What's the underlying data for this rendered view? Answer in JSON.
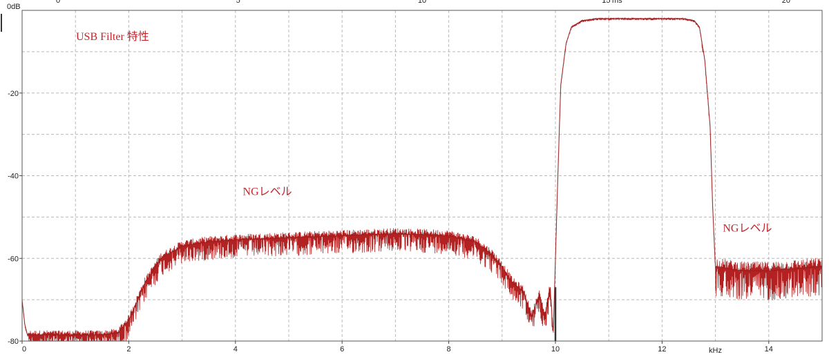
{
  "chart_data": {
    "type": "line",
    "title": "USB  Filter 特性",
    "annotations": [
      {
        "text": "NGレベル",
        "x": 4.6,
        "y": -44.7
      },
      {
        "text": "NGレベル",
        "x": 13.6,
        "y": -53.5
      }
    ],
    "x_unit": "kHz",
    "y_unit": "0dB",
    "top_axis_unit": "ms",
    "xlim": [
      0,
      15
    ],
    "ylim": [
      -80,
      0
    ],
    "x_ticks": [
      "0",
      "2",
      "4",
      "6",
      "8",
      "10",
      "12",
      "14"
    ],
    "y_ticks": [
      "-20",
      "-40",
      "-60",
      "-80"
    ],
    "top_ticks": [
      "0",
      "5",
      "10",
      "15",
      "20"
    ],
    "grid": true,
    "grid_style": "dashed",
    "line_color": "#8b1a1a",
    "noise_color": "#b22222",
    "series": [
      {
        "x": [
          0,
          0.05,
          0.1,
          0.5,
          1.0,
          1.5,
          1.8,
          2.0,
          2.3,
          2.6,
          3.0,
          3.5,
          4.0,
          5.0,
          6.0,
          7.0,
          8.0,
          8.5,
          8.8,
          9.0,
          9.2,
          9.4,
          9.55,
          9.7,
          9.8,
          9.9,
          9.96,
          10.0,
          10.05,
          10.1,
          10.2,
          10.3,
          10.5,
          10.8,
          11.2,
          12.0,
          12.4,
          12.6,
          12.7,
          12.8,
          12.9,
          12.95,
          13.0,
          13.5,
          14.0,
          15.0
        ],
        "y": [
          -70,
          -76,
          -78.5,
          -78.5,
          -78.5,
          -78.5,
          -78,
          -75,
          -66,
          -60,
          -57,
          -56,
          -55.5,
          -55,
          -54.5,
          -54,
          -54.5,
          -56,
          -59,
          -62,
          -66,
          -68,
          -74,
          -69,
          -74,
          -67,
          -78,
          -60,
          -38,
          -18,
          -8,
          -4,
          -2.5,
          -2,
          -2,
          -2,
          -2,
          -2.5,
          -4,
          -12,
          -28,
          -48,
          -62,
          -63,
          -63,
          -62
        ]
      }
    ]
  }
}
